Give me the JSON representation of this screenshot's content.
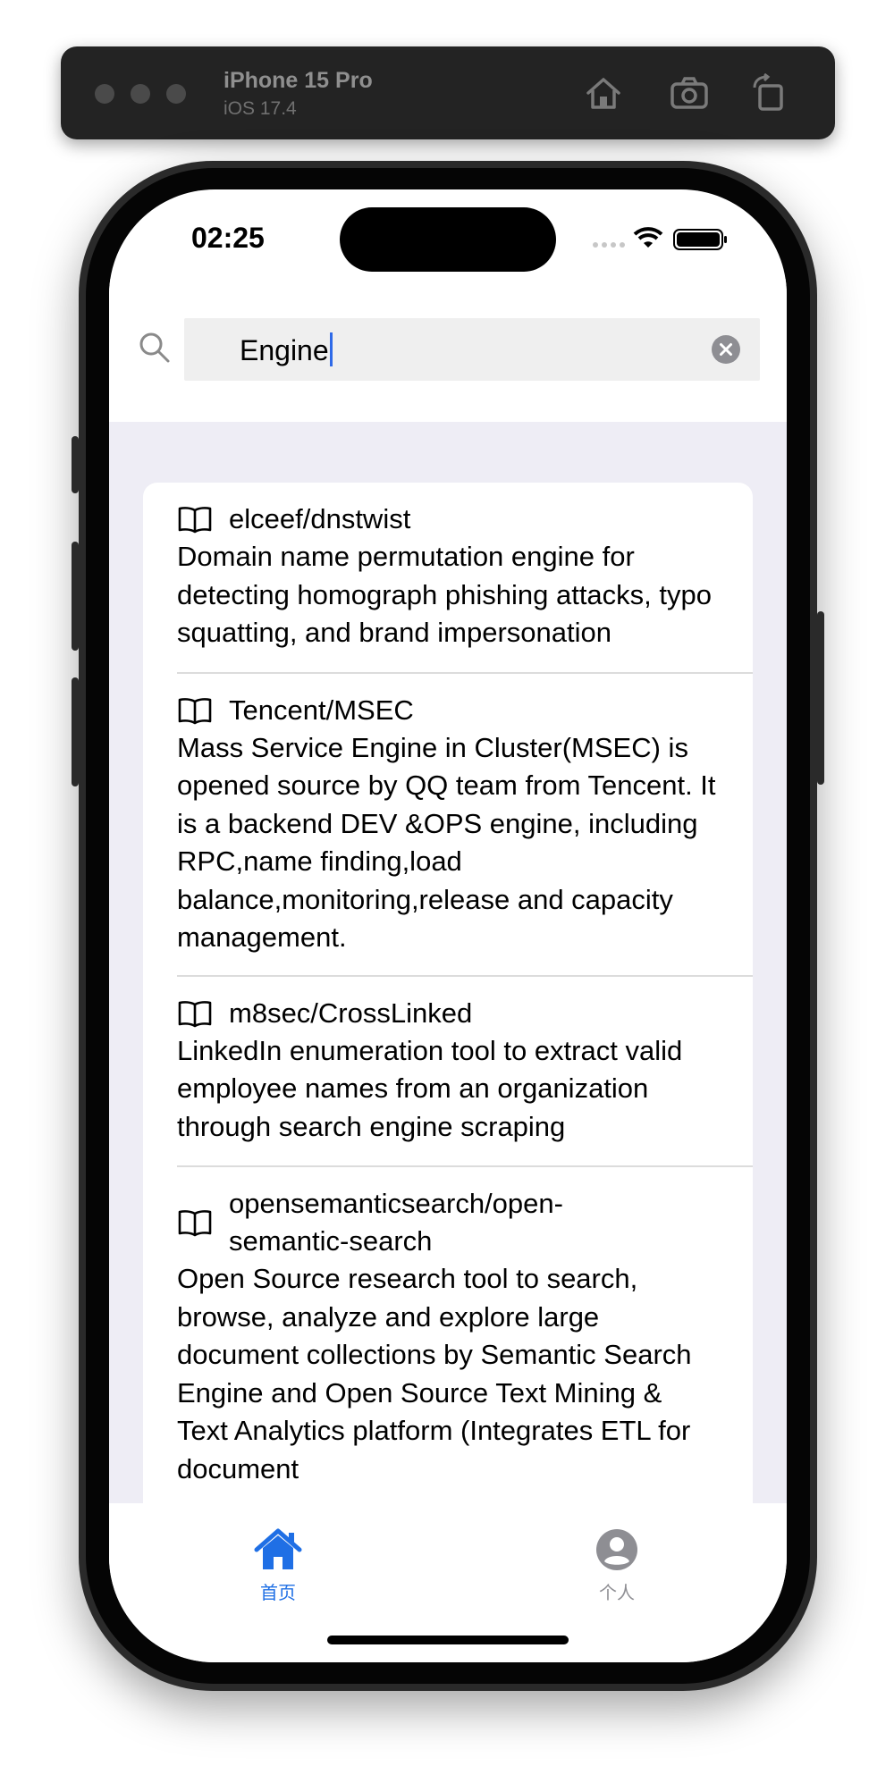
{
  "simulator": {
    "device": "iPhone 15 Pro",
    "os": "iOS 17.4",
    "icons": [
      "home-icon",
      "screenshot-icon",
      "rotate-icon"
    ]
  },
  "status_bar": {
    "time": "02:25"
  },
  "search": {
    "value": "Engine"
  },
  "results": [
    {
      "name": "elceef/dnstwist",
      "description": "Domain name permutation engine for detecting homograph phishing attacks, typo squatting, and brand impersonation"
    },
    {
      "name": "Tencent/MSEC",
      "description": "Mass Service Engine in Cluster(MSEC) is opened source by QQ team from Tencent. It is a backend DEV &OPS engine, including RPC,name finding,load balance,monitoring,release and capacity management."
    },
    {
      "name": "m8sec/CrossLinked",
      "description": "LinkedIn enumeration tool to extract valid employee names from an organization through search engine scraping"
    },
    {
      "name": "opensemanticsearch/open-semantic-search",
      "description": "Open Source research tool to search, browse, analyze and explore large document collections by Semantic Search Engine and Open Source Text Mining & Text Analytics platform (Integrates ETL for document"
    }
  ],
  "tabs": [
    {
      "label": "首页",
      "icon": "house-icon",
      "active": true
    },
    {
      "label": "个人",
      "icon": "person-icon",
      "active": false
    }
  ],
  "colors": {
    "accent": "#1f6fe5",
    "inactive": "#8e8e93",
    "list_background": "#eeedf5"
  }
}
